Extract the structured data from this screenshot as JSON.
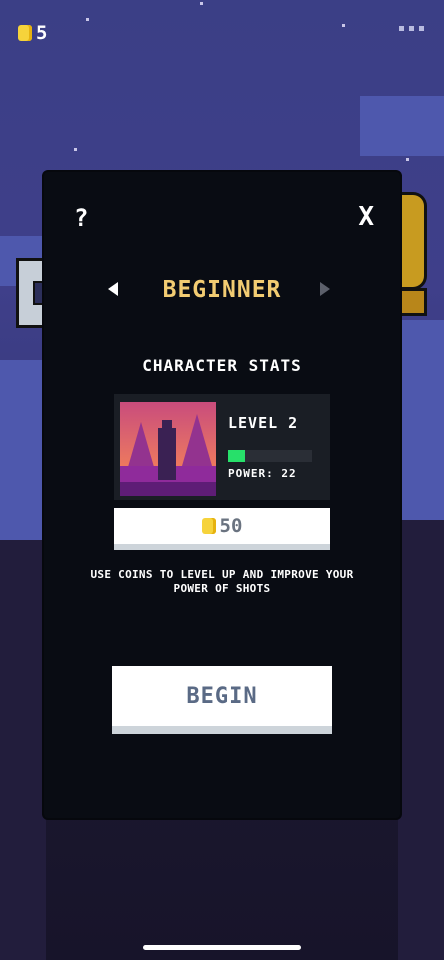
{
  "hud": {
    "coins": "5",
    "coin_icon": "coin-icon",
    "menu_icon": "more-dots-icon"
  },
  "modal": {
    "help_label": "?",
    "close_label": "X",
    "mode_title": "BEGINNER",
    "stats_title": "CHARACTER STATS",
    "character": {
      "level_label": "LEVEL 2",
      "power_label": "POWER: 22",
      "power_progress": 0.2
    },
    "level_up_cost": "50",
    "hint_text": "USE COINS TO LEVEL UP AND IMPROVE YOUR POWER OF SHOTS",
    "begin_label": "BEGIN"
  },
  "colors": {
    "title_gold": "#f2cc72",
    "power_green": "#27e06a",
    "coin_yellow": "#f6d33b",
    "button_text": "#5a6a85"
  }
}
